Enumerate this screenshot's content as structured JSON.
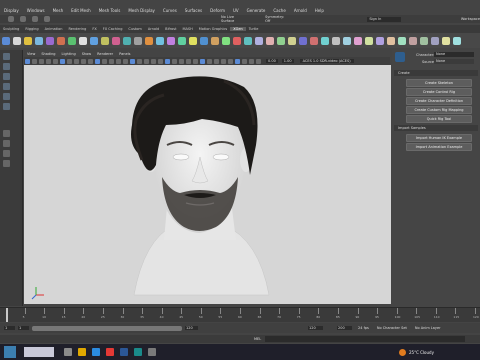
{
  "menu": [
    "Display",
    "Windows",
    "Mesh",
    "Edit Mesh",
    "Mesh Tools",
    "Mesh Display",
    "Curves",
    "Surfaces",
    "Deform",
    "UV",
    "Generate",
    "Cache",
    "Arnold",
    "Help"
  ],
  "workspace": {
    "no_live_surface": "No Live Surface",
    "symmetry": "Symmetry: Off",
    "signin": "Sign In",
    "workspace_label": "Workspace"
  },
  "shelf_tabs": [
    "Sculpting",
    "Rigging",
    "Animation",
    "Rendering",
    "FX",
    "FX Caching",
    "Custom",
    "Arnold",
    "Bifrost",
    "MASH",
    "Motion Graphics",
    "XGen",
    "Turtle"
  ],
  "viewport_menu": [
    "View",
    "Shading",
    "Lighting",
    "Show",
    "Renderer",
    "Panels"
  ],
  "viewport_toolbar": {
    "value1": "0.00",
    "value2": "1.00",
    "colorspace": "ACES 1.0 SDR-video (ACES)"
  },
  "right_panel": {
    "character_label": "Character:",
    "character_value": "None",
    "source_label": "Source:",
    "source_value": "None",
    "create_section": "Create",
    "create_buttons": [
      "Create Skeleton",
      "Create Control Rig",
      "Create Character Definition",
      "Create Custom Rig Mapping",
      "Quick Rig Tool"
    ],
    "import_section": "Import Samples",
    "import_buttons": [
      "Import Human IK Example",
      "Import Animation Example"
    ]
  },
  "timeline": {
    "ticks": [
      "5",
      "10",
      "15",
      "20",
      "25",
      "30",
      "35",
      "40",
      "45",
      "50",
      "55",
      "60",
      "65",
      "70",
      "75",
      "80",
      "85",
      "90",
      "95",
      "100",
      "105",
      "110",
      "115",
      "120"
    ],
    "current": "1"
  },
  "range": {
    "start": "1",
    "start_inner": "1",
    "end_inner": "120",
    "end": "120",
    "end2": "200",
    "fps": "24 fps",
    "no_char": "No Character Set",
    "no_anim_layer": "No Anim Layer"
  },
  "cmdline": {
    "label": "MEL"
  },
  "taskbar": {
    "weather": "25°C Cloudy",
    "temp_icon": "weather-icon"
  },
  "colors": {
    "accent": "#3c7fb1",
    "bg": "#444444",
    "viewport": "#d6d6d6"
  }
}
